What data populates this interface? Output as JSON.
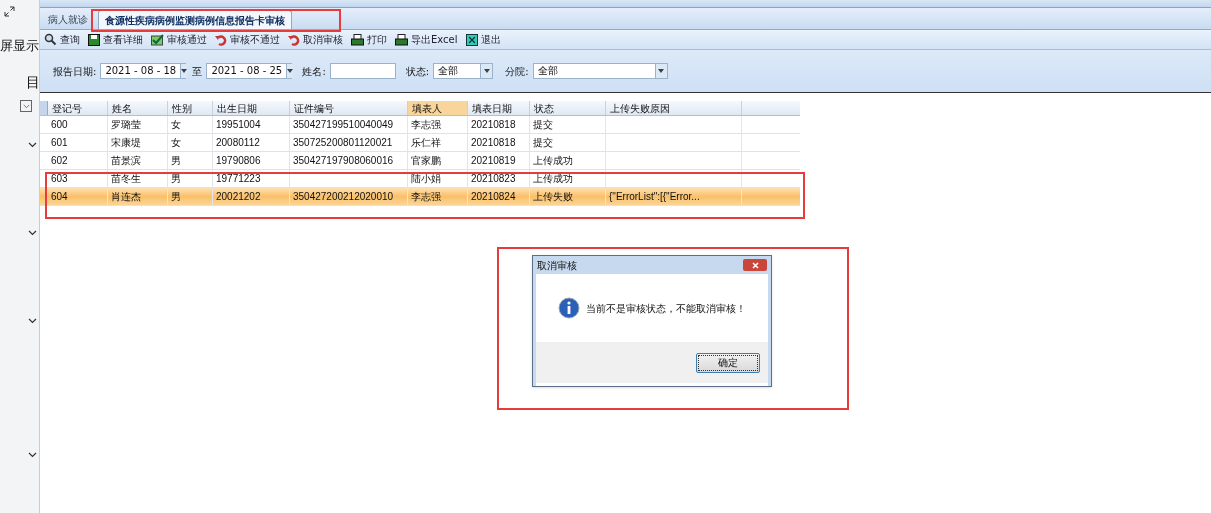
{
  "side_panel": {
    "label": "屏显示",
    "glyph": "目"
  },
  "tabs": [
    {
      "label": "病人就诊",
      "selected": false
    },
    {
      "label": "食源性疾病病例监测病例信息报告卡审核",
      "selected": true
    }
  ],
  "toolbar": [
    {
      "label": "查询",
      "kind": "search"
    },
    {
      "label": "查看详细",
      "kind": "save"
    },
    {
      "label": "审核通过",
      "kind": "check"
    },
    {
      "label": "审核不通过",
      "kind": "undo"
    },
    {
      "label": "取消审核",
      "kind": "undo"
    },
    {
      "label": "打印",
      "kind": "print"
    },
    {
      "label": "导出Excel",
      "kind": "print"
    },
    {
      "label": "退出",
      "kind": "exit"
    }
  ],
  "filters": {
    "date_label": "报告日期:",
    "date_from": "2021 - 08 - 18",
    "to_label": "至",
    "date_to": "2021 - 08 - 25",
    "name_label": "姓名:",
    "status_label": "状态:",
    "status_value": "全部",
    "branch_label": "分院:",
    "branch_value": "全部"
  },
  "table": {
    "columns": [
      {
        "label": "登记号",
        "sorted": false
      },
      {
        "label": "姓名",
        "sorted": false
      },
      {
        "label": "性别",
        "sorted": false
      },
      {
        "label": "出生日期",
        "sorted": false
      },
      {
        "label": "证件编号",
        "sorted": false
      },
      {
        "label": "填表人",
        "sorted": true
      },
      {
        "label": "填表日期",
        "sorted": false
      },
      {
        "label": "状态",
        "sorted": false
      },
      {
        "label": "上传失败原因",
        "sorted": false
      }
    ],
    "rows": [
      {
        "selected": false,
        "cells": [
          "600",
          "罗璐莹",
          "女",
          "19951004",
          "350427199510040049",
          "李志强",
          "20210818",
          "提交",
          ""
        ]
      },
      {
        "selected": false,
        "cells": [
          "601",
          "宋康堤",
          "女",
          "20080112",
          "350725200801120021",
          "乐仁祥",
          "20210818",
          "提交",
          ""
        ]
      },
      {
        "selected": false,
        "cells": [
          "602",
          "苗景滨",
          "男",
          "19790806",
          "350427197908060016",
          "官家鹏",
          "20210819",
          "上传成功",
          ""
        ]
      },
      {
        "selected": false,
        "cells": [
          "603",
          "苗冬生",
          "男",
          "19771223",
          "",
          "陆小娟",
          "20210823",
          "上传成功",
          ""
        ]
      },
      {
        "selected": true,
        "cells": [
          "604",
          "肖连杰",
          "男",
          "20021202",
          "350427200212020010",
          "李志强",
          "20210824",
          "上传失败",
          "{\"ErrorList\":[{\"Error..."
        ]
      }
    ]
  },
  "dialog": {
    "title": "取消审核",
    "message": "当前不是审核状态，不能取消审核！",
    "ok": "确定"
  }
}
